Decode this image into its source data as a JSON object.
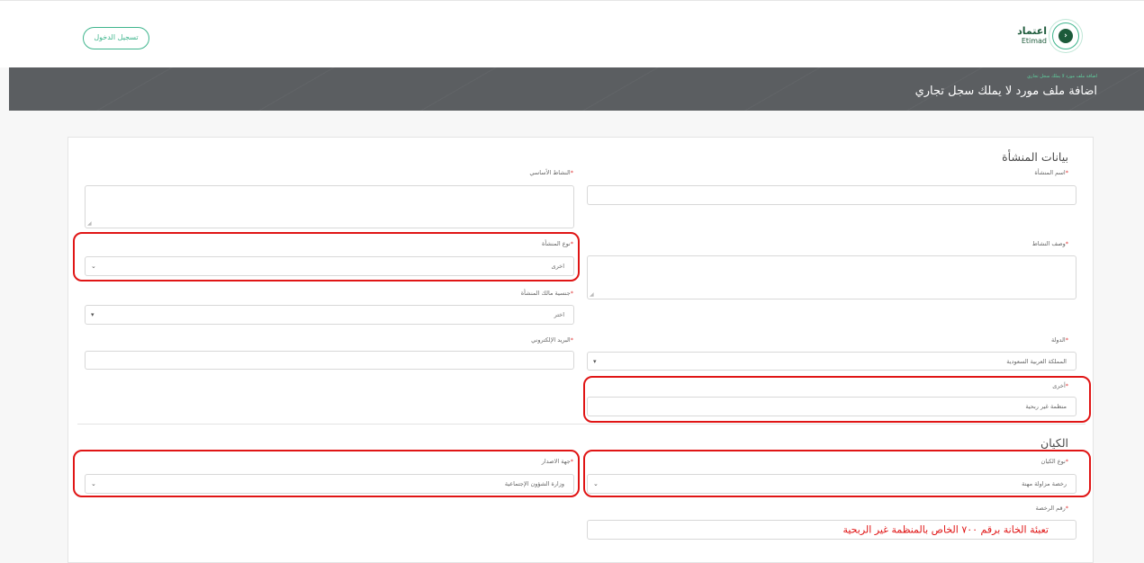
{
  "header": {
    "login_label": "تسجيل الدخول",
    "logo_ar": "اعتماد",
    "logo_en": "Etimad"
  },
  "banner": {
    "breadcrumb": "اضافة ملف مورد لا يملك سجل تجاري",
    "title": "اضافة ملف مورد لا يملك سجل تجاري"
  },
  "facility": {
    "section_title": "بيانات المنشأة",
    "name_label": "اسم المنشأة",
    "main_activity_label": "النشاط الأساسي",
    "activity_desc_label": "وصف النشاط",
    "type_label": "نوع المنشأة",
    "type_value": "اخرى",
    "owner_nationality_label": "جنسية مالك المنشأة",
    "owner_nationality_value": "اختر",
    "email_label": "البريد الإلكتروني",
    "country_label": "الدولة",
    "country_value": "المملكة العربية السعودية",
    "other_label": "أخرى",
    "other_value": "منظمة غير ربحية"
  },
  "entity": {
    "section_title": "الكيان",
    "type_label": "نوع الكيان",
    "type_value": "رخصة مزاولة مهنة",
    "issuer_label": "جهة الاصدار",
    "issuer_value": "وزارة الشؤون الإجتماعية",
    "license_label": "رقم الرخصة",
    "license_note": "تعبئة الخانة برقم ٧٠٠ الخاص بالمنظمة غير الربحية"
  },
  "required_mark": "*",
  "colors": {
    "accent": "#3fb58d",
    "highlight": "#e01515",
    "banner": "#5b5e61"
  }
}
